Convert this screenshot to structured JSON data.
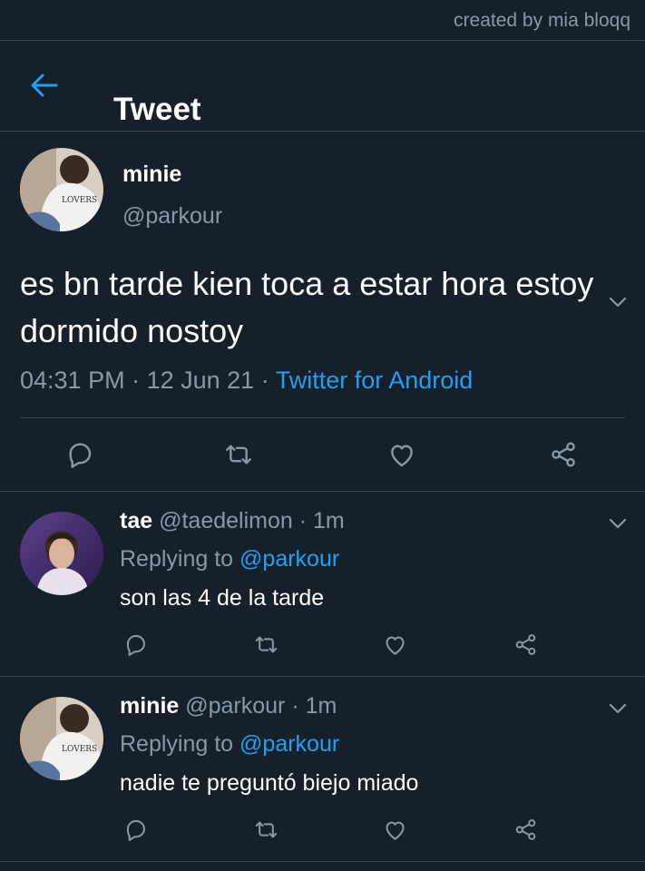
{
  "credit": "created by mia bloqq",
  "header": {
    "title": "Tweet",
    "back_icon": "arrow-left-icon"
  },
  "colors": {
    "background": "#15202b",
    "accent": "#1da1f2",
    "muted": "#8899a6",
    "divider": "#38444d"
  },
  "main_tweet": {
    "name": "minie",
    "handle": "@parkour",
    "text": "es bn tarde kien toca a estar hora estoy dormido nostoy",
    "time": "04:31 PM",
    "sep1": " · ",
    "date": "12 Jun 21",
    "sep2": " · ",
    "source": "Twitter for Android"
  },
  "replies": [
    {
      "name": "tae",
      "meta": " @taedelimon · 1m",
      "replying_prefix": "Replying to ",
      "replying_to": "@parkour",
      "text": "son las 4 de la tarde"
    },
    {
      "name": "minie",
      "meta": " @parkour · 1m",
      "replying_prefix": "Replying to ",
      "replying_to": "@parkour",
      "text": "nadie te preguntó biejo miado"
    }
  ]
}
